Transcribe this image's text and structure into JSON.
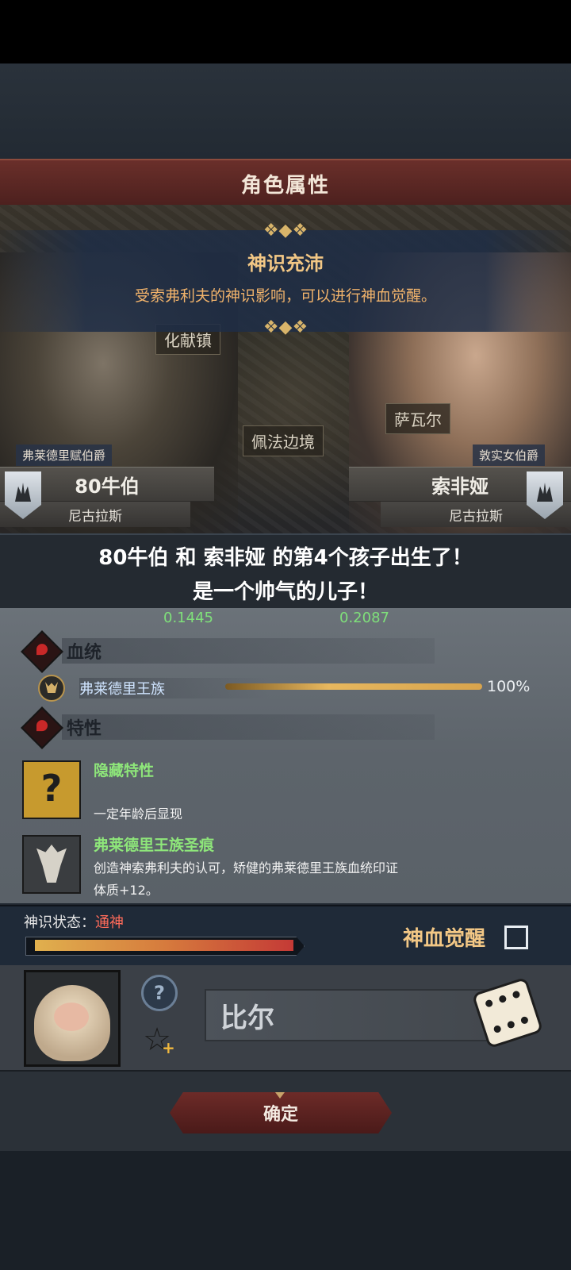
{
  "header": {
    "title": "角色属性"
  },
  "banner": {
    "title": "神识充沛",
    "subtitle": "受索弗利夫的神识影响，可以进行神血觉醒。"
  },
  "map": {
    "labels": [
      "化献镇",
      "佩法边境",
      "萨瓦尔"
    ]
  },
  "father": {
    "rank": "弗莱德里赋伯爵",
    "name": "80牛伯",
    "house": "尼古拉斯"
  },
  "mother": {
    "rank": "敦实女伯爵",
    "name": "索非娅",
    "house": "尼古拉斯"
  },
  "birth_message": {
    "line1": "80牛伯 和 索非娅 的第4个孩子出生了！",
    "line2": "是一个帅气的儿子！"
  },
  "coefficients": {
    "left": "0.1445",
    "right": "0.2087"
  },
  "bloodline": {
    "section_label": "血统",
    "name": "弗莱德里王族",
    "percent_text": "100%",
    "fill_fraction": 1.0
  },
  "traits": {
    "section_label": "特性",
    "items": [
      {
        "title": "隐藏特性",
        "desc": "一定年龄后显现",
        "icon": "question-mark-icon"
      },
      {
        "title": "弗莱德里王族圣痕",
        "desc": "创造神索弗利夫的认可，矫健的弗莱德里王族血统印证",
        "effect": "体质+12。",
        "icon": "holy-sigil-icon"
      }
    ]
  },
  "divine": {
    "label": "神识状态：",
    "state": "通神",
    "fill_fraction": 1.0,
    "awaken_label": "神血觉醒",
    "awaken_checked": false
  },
  "child": {
    "name_value": "比尔"
  },
  "confirm_label": "确定",
  "colors": {
    "accent_gold": "#f2c785",
    "trait_green": "#8ee67a",
    "state_red": "#ff6b5a",
    "button_red": "#6d2b28"
  }
}
